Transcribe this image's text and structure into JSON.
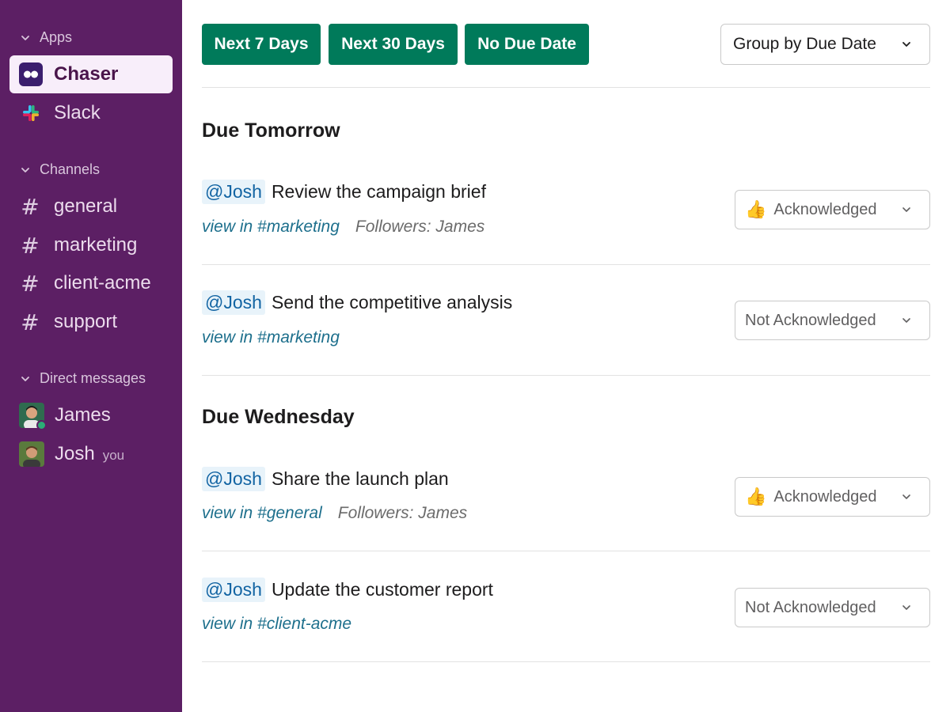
{
  "sidebar": {
    "apps_heading": "Apps",
    "apps": [
      {
        "label": "Chaser",
        "icon": "chaser-logo-icon",
        "active": true
      },
      {
        "label": "Slack",
        "icon": "slack-logo-icon",
        "active": false
      }
    ],
    "channels_heading": "Channels",
    "channels": [
      "general",
      "marketing",
      "client-acme",
      "support"
    ],
    "dms_heading": "Direct messages",
    "dms": [
      {
        "name": "James",
        "online": true,
        "suffix": ""
      },
      {
        "name": "Josh",
        "online": false,
        "suffix": "you"
      }
    ]
  },
  "toolbar": {
    "filters": [
      "Next 7 Days",
      "Next 30 Days",
      "No Due Date"
    ],
    "group_select": "Group by Due Date"
  },
  "groups": [
    {
      "title": "Due Tomorrow",
      "tasks": [
        {
          "mention": "@Josh",
          "text": "Review the campaign brief",
          "link": "view in #marketing",
          "followers": "Followers: James",
          "status": "Acknowledged"
        },
        {
          "mention": "@Josh",
          "text": "Send the competitive analysis",
          "link": "view in #marketing",
          "followers": "",
          "status": "Not Acknowledged"
        }
      ]
    },
    {
      "title": "Due Wednesday",
      "tasks": [
        {
          "mention": "@Josh",
          "text": "Share the launch plan",
          "link": "view in #general",
          "followers": "Followers: James",
          "status": "Acknowledged"
        },
        {
          "mention": "@Josh",
          "text": "Update the customer report",
          "link": "view in #client-acme",
          "followers": "",
          "status": "Not Acknowledged"
        }
      ]
    }
  ],
  "colors": {
    "sidebar_bg": "#5c1f64",
    "button_green": "#007a5a",
    "mention_blue": "#1264a3",
    "link_teal": "#1d6f8c"
  }
}
